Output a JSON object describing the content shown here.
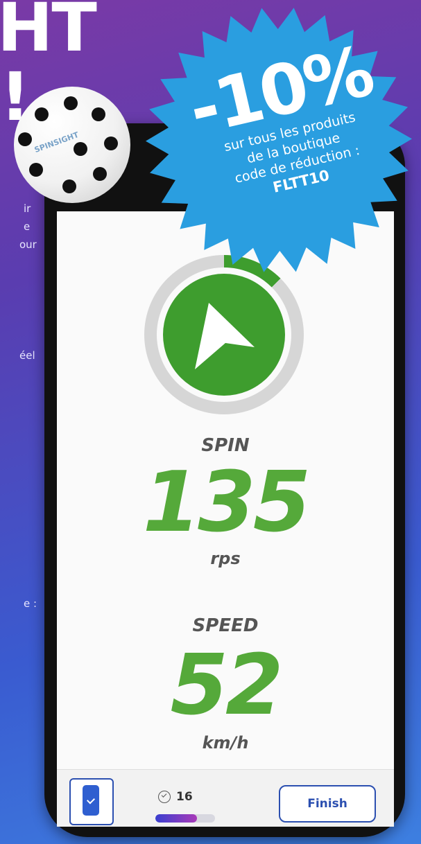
{
  "background": {
    "heading_line1": "HT",
    "heading_line2": "!",
    "fragments": [
      "ir",
      "e",
      "our",
      "éel",
      "e :"
    ]
  },
  "ball": {
    "brand": "SPINSIGHT"
  },
  "promo": {
    "percent": "-10%",
    "line1": "sur tous les produits",
    "line2": "de la boutique",
    "line3": "code de réduction :",
    "code": "FLTT10",
    "color": "#2a9ee0"
  },
  "app": {
    "dial": {
      "icon": "navigation-arrow-icon",
      "fill_fraction": 0.125,
      "accent": "#3e9d2e"
    },
    "spin": {
      "label": "SPIN",
      "value": "135",
      "unit": "rps"
    },
    "speed": {
      "label": "SPEED",
      "value": "52",
      "unit": "km/h"
    },
    "bottom": {
      "device_icon": "device-check-icon",
      "count": "16",
      "count_icon": "check-circle-icon",
      "progress_fraction": 0.7,
      "finish_label": "Finish"
    }
  }
}
